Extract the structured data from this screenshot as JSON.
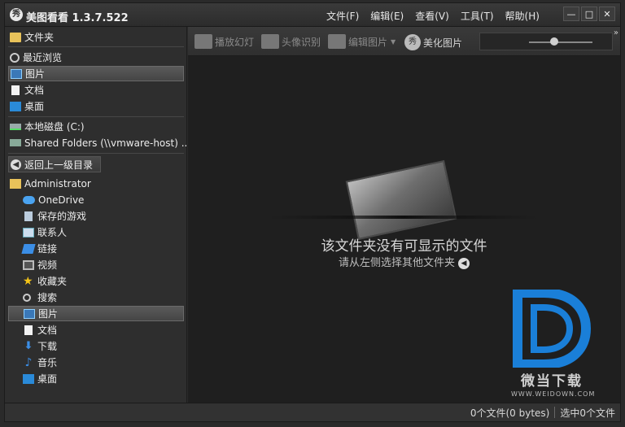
{
  "app": {
    "title": "美图看看 1.3.7.522",
    "icon_glyph": "秀"
  },
  "menu": [
    "文件(F)",
    "编辑(E)",
    "查看(V)",
    "工具(T)",
    "帮助(H)"
  ],
  "window_buttons": {
    "minimize": "—",
    "maximize": "□",
    "close": "✕"
  },
  "sidebar": {
    "favorites_header": "文件夹",
    "favorites": [
      {
        "label": "最近浏览",
        "icon": "clock-icon"
      },
      {
        "label": "图片",
        "icon": "pictures-icon",
        "selected": true
      },
      {
        "label": "文档",
        "icon": "document-icon"
      },
      {
        "label": "桌面",
        "icon": "desktop-icon"
      }
    ],
    "drives": [
      {
        "label": "本地磁盘 (C:)",
        "icon": "disk-icon"
      },
      {
        "label": "Shared Folders (\\\\vmware-host) ...",
        "icon": "network-drive-icon"
      }
    ],
    "back_button": "返回上一级目录",
    "tree_root": "Administrator",
    "tree": [
      {
        "label": "OneDrive",
        "icon": "cloud-icon"
      },
      {
        "label": "保存的游戏",
        "icon": "game-icon"
      },
      {
        "label": "联系人",
        "icon": "contacts-icon"
      },
      {
        "label": "链接",
        "icon": "link-icon"
      },
      {
        "label": "视频",
        "icon": "video-icon"
      },
      {
        "label": "收藏夹",
        "icon": "star-icon"
      },
      {
        "label": "搜索",
        "icon": "search-icon"
      },
      {
        "label": "图片",
        "icon": "pictures-icon",
        "selected": true
      },
      {
        "label": "文档",
        "icon": "document-icon"
      },
      {
        "label": "下载",
        "icon": "download-icon"
      },
      {
        "label": "音乐",
        "icon": "music-icon"
      },
      {
        "label": "桌面",
        "icon": "desktop-icon"
      }
    ]
  },
  "toolbar": {
    "slideshow": "播放幻灯",
    "face_recognition": "头像识别",
    "edit_image": "编辑图片",
    "beautify": "美化图片",
    "beautify_glyph": "秀",
    "more": "»"
  },
  "content": {
    "empty_title": "该文件夹没有可显示的文件",
    "empty_hint": "请从左侧选择其他文件夹"
  },
  "watermark": {
    "text": "微当下载",
    "url": "WWW.WEIDOWN.COM",
    "brand_color": "#1a7fd8"
  },
  "status": {
    "files": "0个文件(0 bytes)",
    "selected": "选中0个文件"
  }
}
